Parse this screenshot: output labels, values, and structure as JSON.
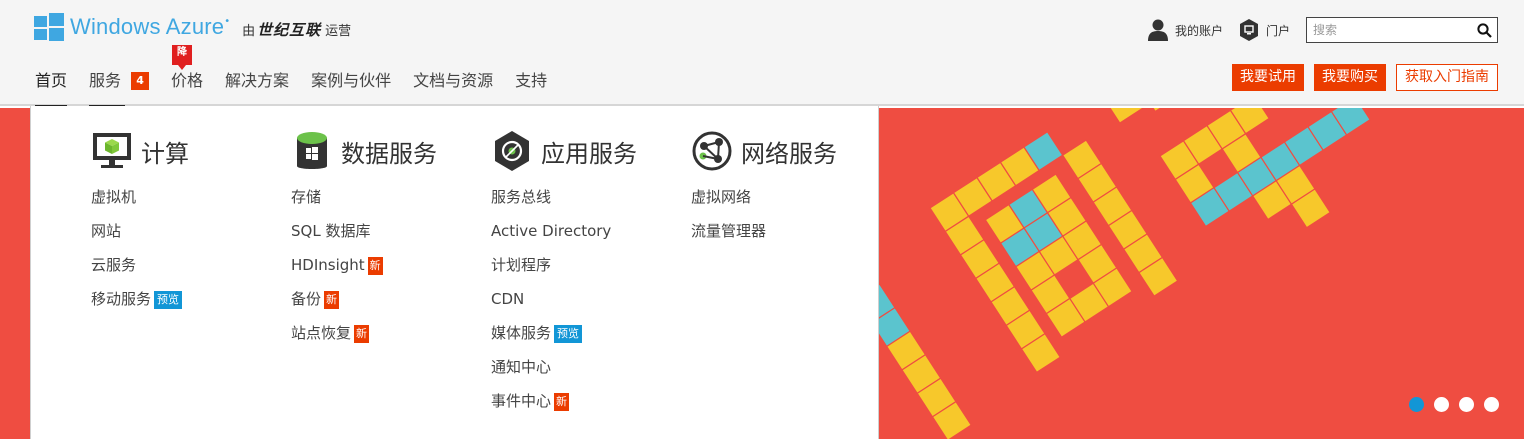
{
  "logo": {
    "text": "Windows Azure",
    "tm": "•",
    "by": "由",
    "brand": "世纪互联",
    "operated": "运营"
  },
  "utils": {
    "account": "我的账户",
    "portal": "门户",
    "search_placeholder": "搜索"
  },
  "nav": [
    {
      "label": "首页",
      "active": true
    },
    {
      "label": "服务",
      "count": "4"
    },
    {
      "label": "价格",
      "flag": "降"
    },
    {
      "label": "解决方案"
    },
    {
      "label": "案例与伙伴"
    },
    {
      "label": "文档与资源"
    },
    {
      "label": "支持"
    }
  ],
  "ctas": {
    "trial": "我要试用",
    "buy": "我要购买",
    "guide": "获取入门指南"
  },
  "menu": {
    "compute": {
      "title": "计算",
      "items": [
        "虚拟机",
        "网站",
        "云服务",
        "移动服务"
      ],
      "preview_tag": "预览"
    },
    "data": {
      "title": "数据服务",
      "items": [
        "存储",
        "SQL 数据库",
        "HDInsight",
        "备份",
        "站点恢复"
      ],
      "new_tag": "新"
    },
    "app": {
      "title": "应用服务",
      "items": [
        "服务总线",
        "Active Directory",
        "计划程序",
        "CDN",
        "媒体服务",
        "通知中心",
        "事件中心"
      ],
      "new_tag": "新",
      "preview_tag": "预览"
    },
    "network": {
      "title": "网络服务",
      "items": [
        "虚拟网络",
        "流量管理器"
      ]
    }
  },
  "colors": {
    "accent": "#eb3c00",
    "brand_blue": "#3fa7e1",
    "hero_bg": "#ef4d41",
    "tile_yellow": "#f7c82b",
    "tile_teal": "#5bc4ce"
  },
  "carousel": {
    "slides": 4,
    "active": 1
  }
}
